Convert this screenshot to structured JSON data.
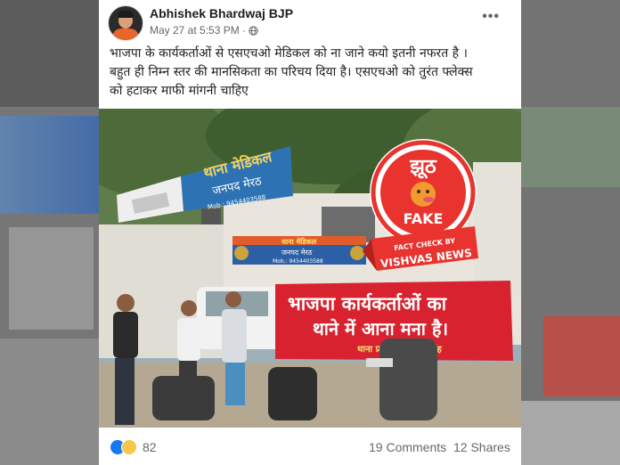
{
  "post": {
    "author": "Abhishek Bhardwaj BJP",
    "date": "May 27 at 5:53 PM",
    "privacy_icon": "globe-icon",
    "more_icon": "more-options-icon",
    "text_line1": "भाजपा के कार्यकर्ताओं से एसएचओ मेडिकल को ना जाने कयो इतनी नफरत है ।",
    "text_line2": "बहुत ही निम्न स्तर की मानसिकता का परिचय दिया है। एसएचओ को तुरंत फ्लेक्स",
    "text_line3": "को हटाकर माफी मांगनी चाहिए"
  },
  "photo": {
    "station_sign_main": "थाना मेडिकल",
    "station_sign_sub": "जनपद मेरठ",
    "station_sign_phone": "Mob.: 9454403588",
    "sign2_main": "थाना मेडिकल",
    "sign2_sub": "जनपद मेरठ",
    "sign2_phone": "Mob.: 9454403588",
    "banner_line1": "भाजपा कार्यकर्ताओं का",
    "banner_line2": "थाने में आना मना है।",
    "banner_line3": "थाना प्रभारी सतशरण सिंह",
    "stamp_top": "झूठ",
    "stamp_label": "FAKE",
    "stamp_ribbon_small": "FACT CHECK BY",
    "stamp_ribbon_big": "VISHVAS NEWS"
  },
  "footer": {
    "reaction_count": "82",
    "comments": "19 Comments",
    "shares": "12 Shares",
    "reaction_icons": [
      "like-icon",
      "sad-icon"
    ]
  },
  "colors": {
    "banner_red": "#d8222f",
    "stamp_red": "#e8332e",
    "like_blue": "#1877f2",
    "sad_yellow": "#f7c64a"
  }
}
